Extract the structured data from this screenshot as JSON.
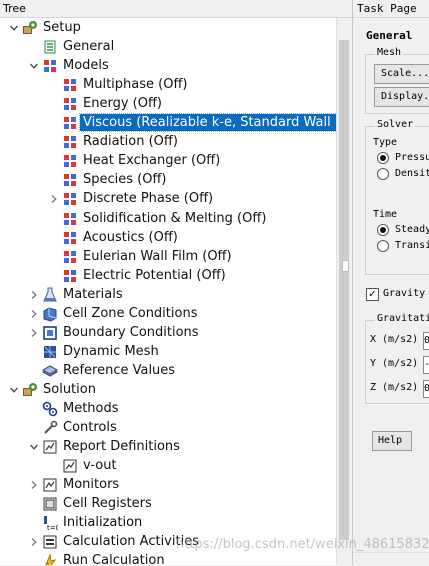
{
  "tree_panel": {
    "header": "Tree",
    "items": [
      {
        "label": "Setup",
        "expander": "expanded",
        "icon": "setup-icon"
      },
      {
        "label": "General",
        "expander": "",
        "icon": "general-icon"
      },
      {
        "label": "Models",
        "expander": "expanded",
        "icon": "models-icon"
      },
      {
        "label": "Multiphase (Off)",
        "expander": "",
        "icon": "model-icon"
      },
      {
        "label": "Energy (Off)",
        "expander": "",
        "icon": "model-icon"
      },
      {
        "label": "Viscous (Realizable k-e, Standard Wall Fn)",
        "expander": "",
        "icon": "model-icon",
        "selected": true
      },
      {
        "label": "Radiation (Off)",
        "expander": "",
        "icon": "model-icon"
      },
      {
        "label": "Heat Exchanger (Off)",
        "expander": "",
        "icon": "model-icon"
      },
      {
        "label": "Species (Off)",
        "expander": "",
        "icon": "model-icon"
      },
      {
        "label": "Discrete Phase (Off)",
        "expander": "collapsed",
        "icon": "model-icon"
      },
      {
        "label": "Solidification & Melting (Off)",
        "expander": "",
        "icon": "model-icon"
      },
      {
        "label": "Acoustics (Off)",
        "expander": "",
        "icon": "model-icon"
      },
      {
        "label": "Eulerian Wall Film (Off)",
        "expander": "",
        "icon": "model-icon"
      },
      {
        "label": "Electric Potential (Off)",
        "expander": "",
        "icon": "model-icon"
      },
      {
        "label": "Materials",
        "expander": "collapsed",
        "icon": "materials-icon"
      },
      {
        "label": "Cell Zone Conditions",
        "expander": "collapsed",
        "icon": "cell-zone-icon"
      },
      {
        "label": "Boundary Conditions",
        "expander": "collapsed",
        "icon": "boundary-icon"
      },
      {
        "label": "Dynamic Mesh",
        "expander": "",
        "icon": "dynamic-mesh-icon"
      },
      {
        "label": "Reference Values",
        "expander": "",
        "icon": "reference-values-icon"
      },
      {
        "label": "Solution",
        "expander": "expanded",
        "icon": "solution-icon"
      },
      {
        "label": "Methods",
        "expander": "",
        "icon": "methods-icon"
      },
      {
        "label": "Controls",
        "expander": "",
        "icon": "controls-icon"
      },
      {
        "label": "Report Definitions",
        "expander": "expanded",
        "icon": "report-icon"
      },
      {
        "label": "v-out",
        "expander": "",
        "icon": "report-item-icon"
      },
      {
        "label": "Monitors",
        "expander": "collapsed",
        "icon": "monitors-icon"
      },
      {
        "label": "Cell Registers",
        "expander": "",
        "icon": "cell-registers-icon"
      },
      {
        "label": "Initialization",
        "expander": "",
        "icon": "initialization-icon"
      },
      {
        "label": "Calculation Activities",
        "expander": "collapsed",
        "icon": "calculation-activities-icon"
      },
      {
        "label": "Run Calculation",
        "expander": "",
        "icon": "run-calculation-icon"
      }
    ]
  },
  "task_panel": {
    "header": "Task Page",
    "title": "General",
    "mesh": {
      "label": "Mesh",
      "buttons": [
        "Scale...",
        "Display..."
      ]
    },
    "solver": {
      "label": "Solver",
      "type_label": "Type",
      "type_options": [
        {
          "label": "Pressure-Based",
          "selected": true
        },
        {
          "label": "Density-Based",
          "selected": false
        }
      ],
      "time_label": "Time",
      "time_options": [
        {
          "label": "Steady",
          "selected": true
        },
        {
          "label": "Transient",
          "selected": false
        }
      ]
    },
    "gravity": {
      "label": "Gravity",
      "checked": true
    },
    "gravitational": {
      "label": "Gravitational Acceleration",
      "fields": [
        {
          "label": "X (m/s2)",
          "value": "0"
        },
        {
          "label": "Y (m/s2)",
          "value": "-"
        },
        {
          "label": "Z (m/s2)",
          "value": "0"
        }
      ]
    },
    "help_button": "Help"
  },
  "watermark": "https://blog.csdn.net/weixin_48615832"
}
